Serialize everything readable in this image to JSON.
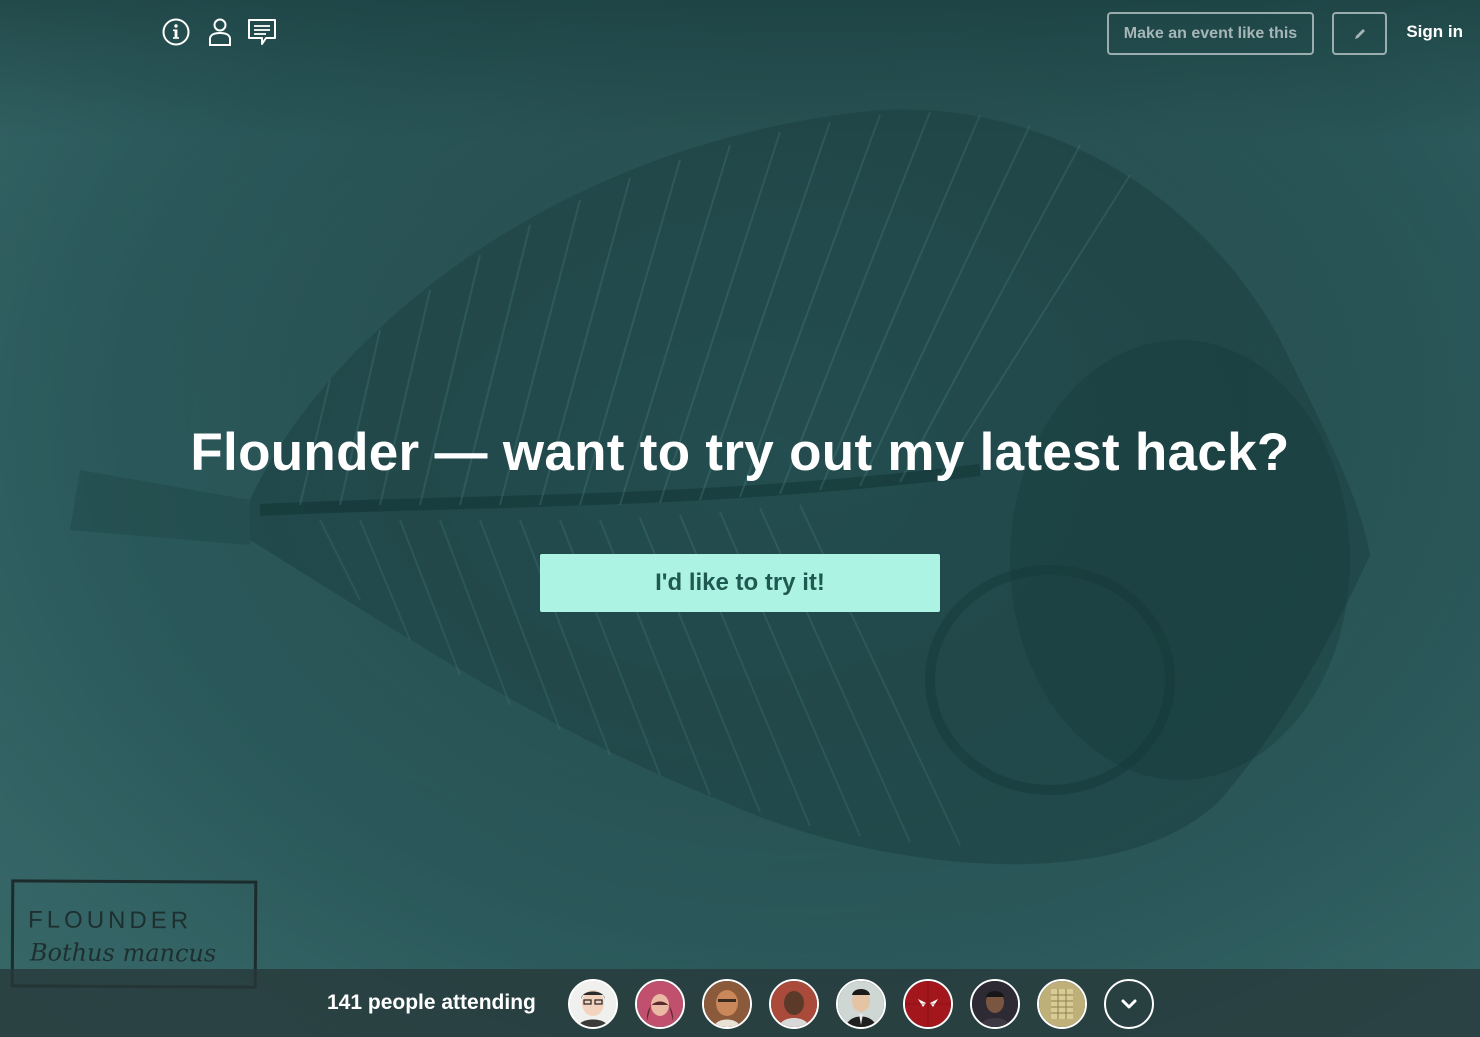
{
  "topbar": {
    "icons": [
      "info-icon",
      "person-icon",
      "chat-icon"
    ],
    "make_event_label": "Make an event like this",
    "edit_icon": "pencil-icon",
    "sign_in_label": "Sign in"
  },
  "hero": {
    "headline": "Flounder — want to try out my latest hack?",
    "cta_label": "I'd like to try it!",
    "cta_color": "#adf3e3",
    "cta_text_color": "#1f5a52",
    "background_color": "#2d5a5c"
  },
  "background_label": {
    "name": "FLOUNDER",
    "latin": "Bothus mancus"
  },
  "attendance": {
    "count_text": "141 people attending",
    "avatars": [
      "avatar-1",
      "avatar-2",
      "avatar-3",
      "avatar-4",
      "avatar-5",
      "avatar-6",
      "avatar-7",
      "avatar-8"
    ],
    "more_icon": "chevron-down-icon"
  }
}
